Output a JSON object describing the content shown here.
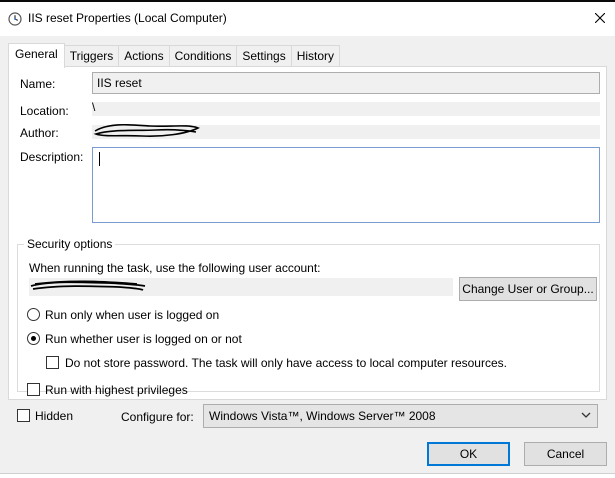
{
  "window": {
    "title": "IIS reset Properties (Local Computer)"
  },
  "tabs": [
    "General",
    "Triggers",
    "Actions",
    "Conditions",
    "Settings",
    "History"
  ],
  "general": {
    "name_label": "Name:",
    "name_value": "IIS reset",
    "location_label": "Location:",
    "location_value": "\\",
    "author_label": "Author:",
    "description_label": "Description:",
    "description_value": ""
  },
  "security": {
    "group_title": "Security options",
    "account_prompt": "When running the task, use the following user account:",
    "change_user_button": "Change User or Group...",
    "run_logged_on": "Run only when user is logged on",
    "run_whether": "Run whether user is logged on or not",
    "no_store_password": "Do not store password.  The task will only have access to local computer resources.",
    "highest_privileges": "Run with highest privileges"
  },
  "bottom": {
    "hidden_label": "Hidden",
    "configure_label": "Configure for:",
    "configure_value": "Windows Vista™, Windows Server™ 2008"
  },
  "buttons": {
    "ok": "OK",
    "cancel": "Cancel"
  },
  "colors": {
    "accent": "#0078d7",
    "window_bg": "#f0f0f0",
    "field_border": "#7a9cd3"
  },
  "icons": {
    "title": "clock-icon",
    "close": "close-icon",
    "dropdown": "chevron-down-icon"
  }
}
